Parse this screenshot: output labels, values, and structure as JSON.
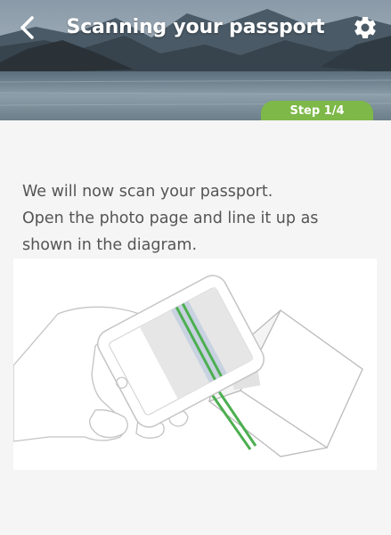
{
  "header": {
    "title": "Scanning your passport",
    "back_icon": "chevron-left-icon",
    "settings_icon": "gear-icon",
    "step_label": "Step 1/4"
  },
  "instructions": {
    "line1": "We will now scan your passport.",
    "line2": "Open the photo page and line it up as",
    "line3": "shown in the diagram."
  },
  "colors": {
    "accent_green": "#7db848",
    "scan_line_green": "#4caf50",
    "text_gray": "#555555",
    "background": "#f5f5f5"
  }
}
